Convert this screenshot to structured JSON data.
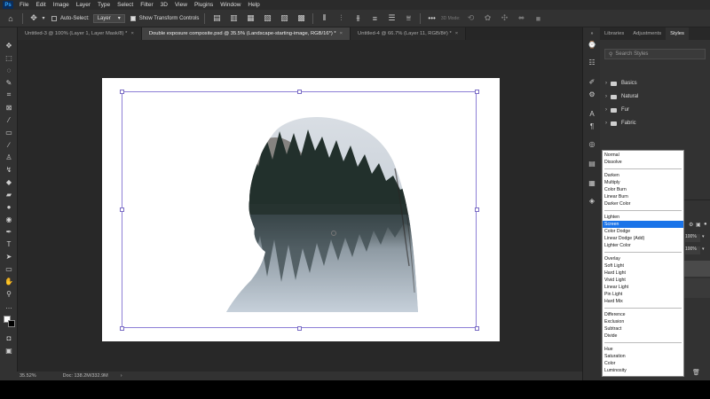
{
  "menubar": {
    "logo": "Ps",
    "items": [
      "File",
      "Edit",
      "Image",
      "Layer",
      "Type",
      "Select",
      "Filter",
      "3D",
      "View",
      "Plugins",
      "Window",
      "Help"
    ]
  },
  "options": {
    "auto_select_label": "Auto-Select:",
    "auto_select_value": "Layer",
    "transform_controls_label": "Show Transform Controls",
    "more": "•••",
    "mode_3d": "3D Mode:"
  },
  "tabs": [
    {
      "label": "Untitled-3 @ 100% (Layer 1, Layer Mask/8) *",
      "active": false
    },
    {
      "label": "Double exposure composite.psd @ 35.5% (Landscape-starting-image, RGB/16*) *",
      "active": true
    },
    {
      "label": "Untitled-4 @ 66.7% (Layer 11, RGB/8#) *",
      "active": false
    }
  ],
  "status": {
    "zoom": "35.52%",
    "doc": "Doc: 138.2M/332.9M"
  },
  "panel": {
    "tabs": [
      "Libraries",
      "Adjustments",
      "Styles"
    ],
    "active_tab": "Styles",
    "search_placeholder": "Search Styles",
    "groups": [
      "Basics",
      "Natural",
      "Fur",
      "Fabric"
    ],
    "opacity": "100%",
    "fill": "100%"
  },
  "blend_modes": {
    "groups": [
      [
        "Normal",
        "Dissolve"
      ],
      [
        "Darken",
        "Multiply",
        "Color Burn",
        "Linear Burn",
        "Darker Color"
      ],
      [
        "Lighten",
        "Screen",
        "Color Dodge",
        "Linear Dodge (Add)",
        "Lighter Color"
      ],
      [
        "Overlay",
        "Soft Light",
        "Hard Light",
        "Vivid Light",
        "Linear Light",
        "Pin Light",
        "Hard Mix"
      ],
      [
        "Difference",
        "Exclusion",
        "Subtract",
        "Divide"
      ],
      [
        "Hue",
        "Saturation",
        "Color",
        "Luminosity"
      ]
    ],
    "selected": "Screen"
  },
  "colors": {
    "accent": "#1a73e8",
    "bbox": "#8d7fd6"
  }
}
